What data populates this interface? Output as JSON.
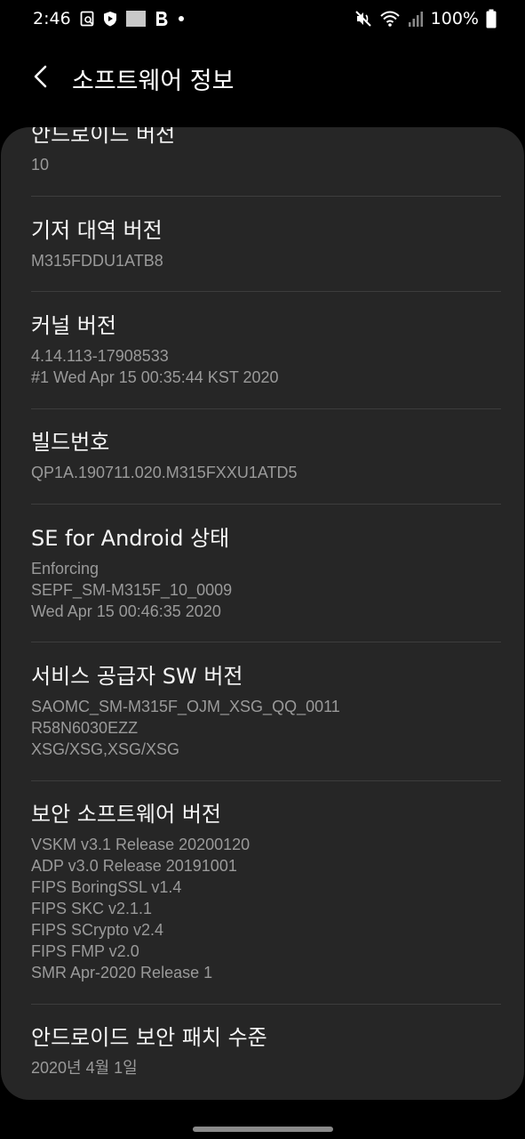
{
  "status_bar": {
    "time": "2:46",
    "battery": "100%"
  },
  "header": {
    "title": "소프트웨어 정보"
  },
  "items": [
    {
      "title": "안드로이드 버전",
      "values": [
        "10"
      ]
    },
    {
      "title": "기저 대역 버전",
      "values": [
        "M315FDDU1ATB8"
      ]
    },
    {
      "title": "커널 버전",
      "values": [
        "4.14.113-17908533",
        "#1 Wed Apr 15 00:35:44 KST 2020"
      ]
    },
    {
      "title": "빌드번호",
      "values": [
        "QP1A.190711.020.M315FXXU1ATD5"
      ]
    },
    {
      "title": "SE for Android 상태",
      "values": [
        "Enforcing",
        "SEPF_SM-M315F_10_0009",
        "Wed Apr 15 00:46:35 2020"
      ]
    },
    {
      "title": "서비스 공급자 SW 버전",
      "values": [
        "SAOMC_SM-M315F_OJM_XSG_QQ_0011",
        "R58N6030EZZ",
        "XSG/XSG,XSG/XSG"
      ]
    },
    {
      "title": "보안 소프트웨어 버전",
      "values": [
        "VSKM v3.1 Release 20200120",
        "ADP v3.0 Release 20191001",
        "FIPS BoringSSL v1.4",
        "FIPS SKC v2.1.1",
        "FIPS SCrypto v2.4",
        "FIPS FMP v2.0",
        "SMR Apr-2020 Release 1"
      ]
    },
    {
      "title": "안드로이드 보안 패치 수준",
      "values": [
        "2020년 4월 1일"
      ]
    }
  ],
  "icons": {
    "back": "back-arrow-icon",
    "mute": "mute-icon",
    "wifi": "wifi-icon",
    "signal": "signal-icon",
    "battery": "battery-icon"
  }
}
